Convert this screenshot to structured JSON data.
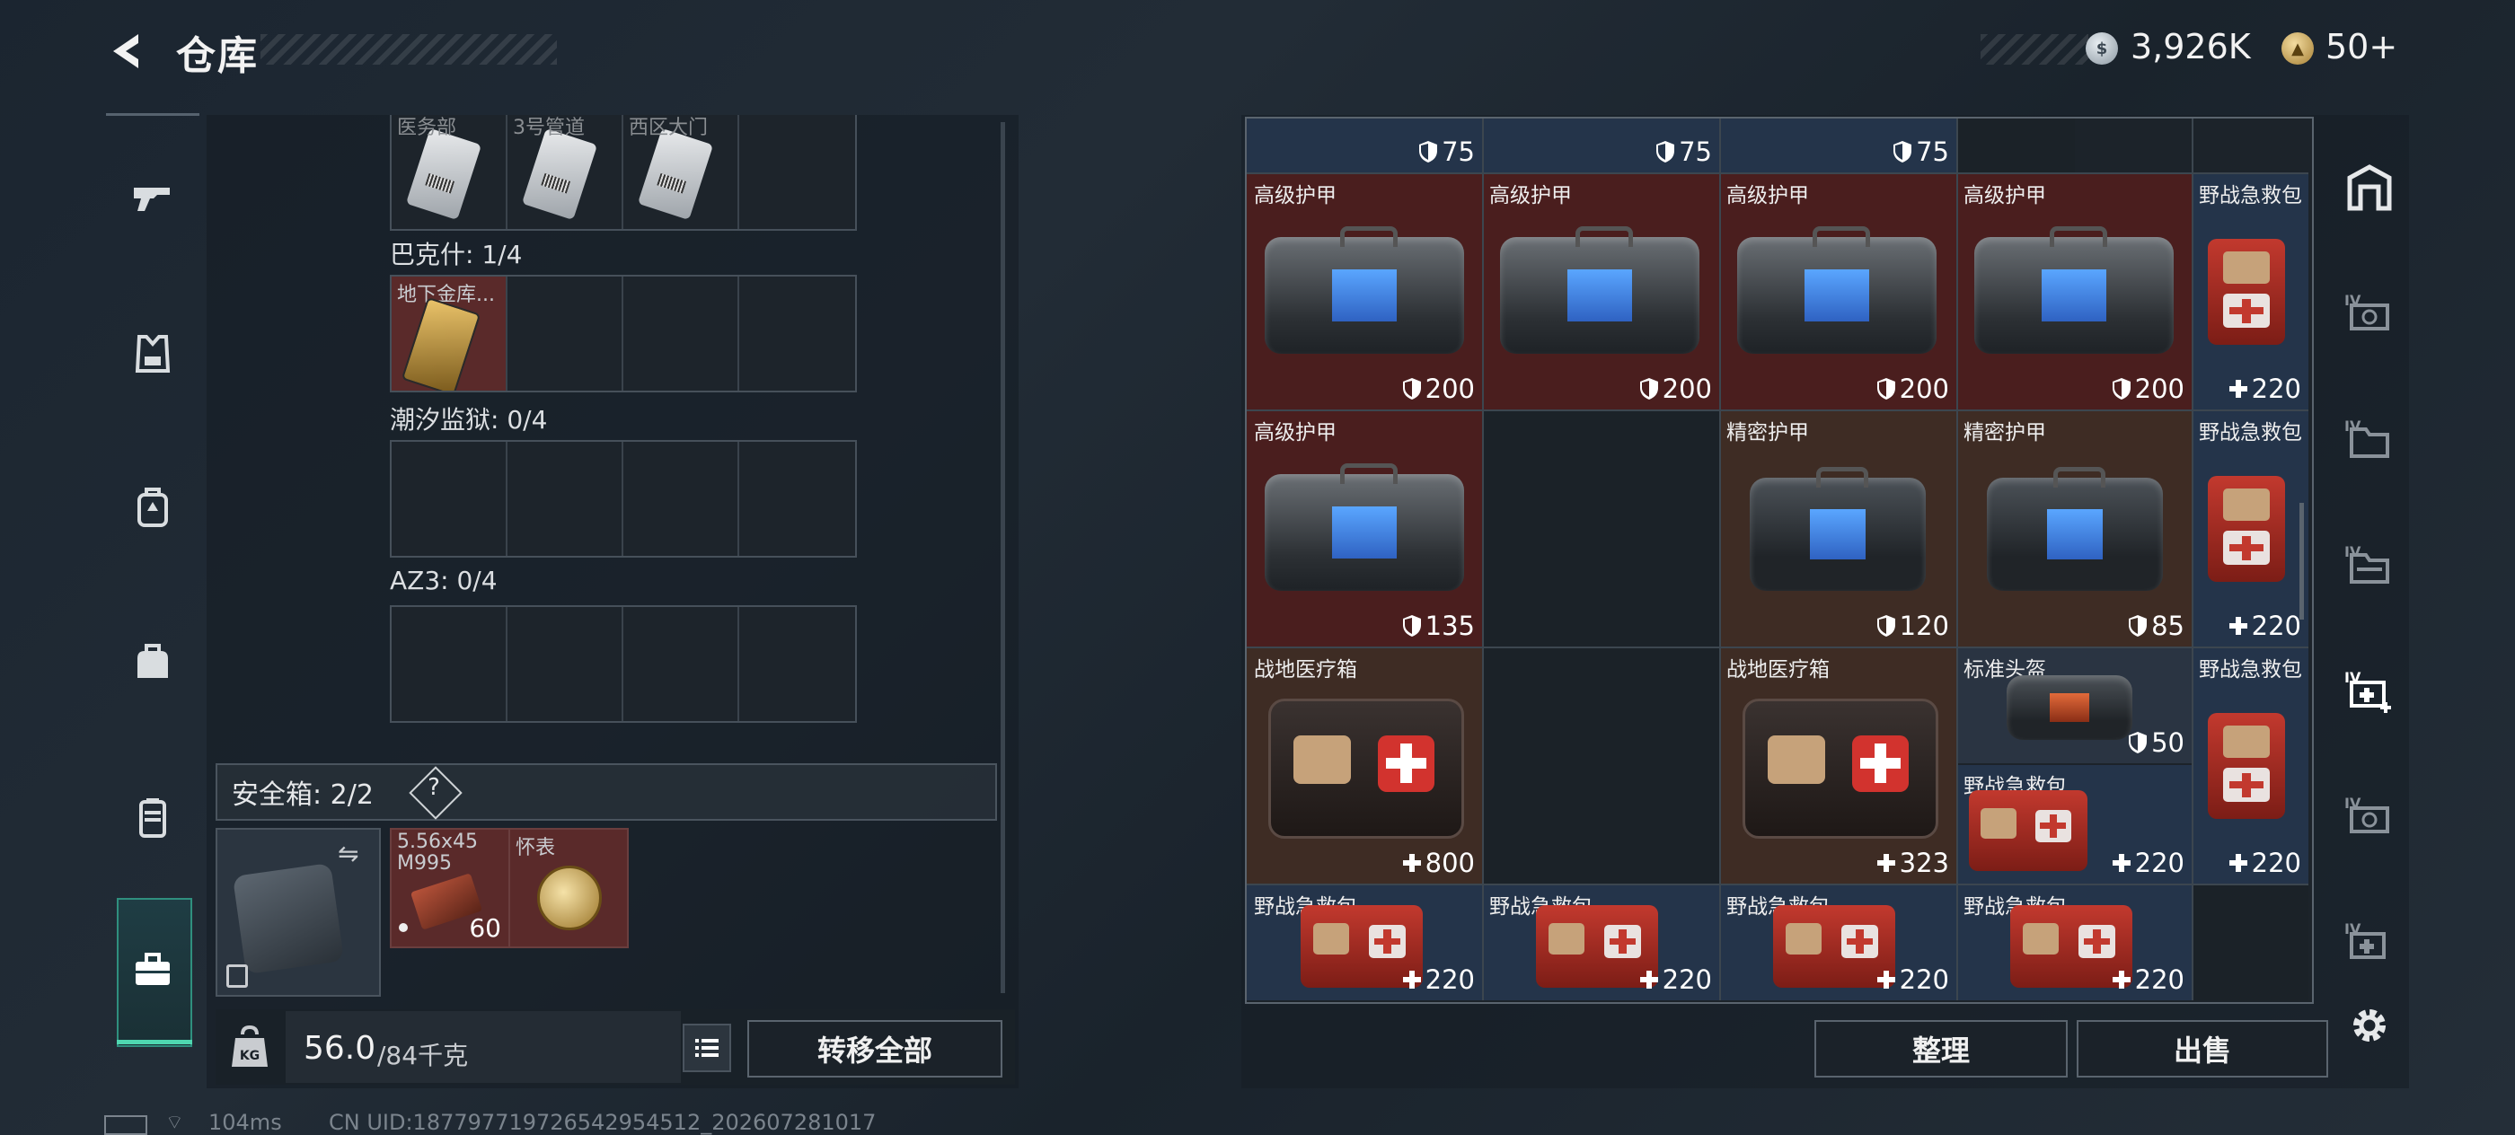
{
  "header": {
    "title": "仓库",
    "currency_silver": "3,926K",
    "currency_gold": "50+"
  },
  "left_nav": [
    {
      "name": "weapon"
    },
    {
      "name": "armor"
    },
    {
      "name": "backpack"
    },
    {
      "name": "bag"
    },
    {
      "name": "case"
    },
    {
      "name": "storage"
    }
  ],
  "key_sections": {
    "top_row": [
      {
        "label": "医务部"
      },
      {
        "label": "3号管道"
      },
      {
        "label": "西区大门"
      },
      {
        "label": ""
      }
    ],
    "bakeshi": {
      "label": "巴克什: 1/4",
      "items": [
        {
          "label": "地下金库..."
        }
      ]
    },
    "chaoxi": {
      "label": "潮汐监狱: 0/4"
    },
    "az3": {
      "label": "AZ3: 0/4"
    }
  },
  "safe_box": {
    "label": "安全箱: 2/2",
    "help": "?",
    "items": [
      {
        "label": "5.56x45 M995",
        "count": "60"
      },
      {
        "label": "怀表"
      }
    ]
  },
  "weight": {
    "value": "56.0",
    "max": "/84千克"
  },
  "buttons": {
    "transfer_all": "转移全部",
    "sort": "整理",
    "sell": "出售"
  },
  "status": {
    "ping": "104ms",
    "uid": "CN UID:187797719726542954512_202607281017"
  },
  "grid": {
    "top_row_values": [
      "75",
      "75",
      "75"
    ],
    "items": [
      {
        "label": "高级护甲",
        "value": "200",
        "kind": "armor"
      },
      {
        "label": "高级护甲",
        "value": "200",
        "kind": "armor"
      },
      {
        "label": "高级护甲",
        "value": "200",
        "kind": "armor"
      },
      {
        "label": "高级护甲",
        "value": "200",
        "kind": "armor"
      },
      {
        "label": "野战急救包",
        "value": "220",
        "kind": "heal"
      },
      {
        "label": "高级护甲",
        "value": "135",
        "kind": "armor"
      },
      {
        "label": "精密护甲",
        "value": "120",
        "kind": "armor"
      },
      {
        "label": "精密护甲",
        "value": "85",
        "kind": "armor"
      },
      {
        "label": "野战急救包",
        "value": "220",
        "kind": "heal"
      },
      {
        "label": "战地医疗箱",
        "value": "800",
        "kind": "heal"
      },
      {
        "label": "战地医疗箱",
        "value": "323",
        "kind": "heal"
      },
      {
        "label": "标准头盔",
        "value": "50",
        "kind": "armor"
      },
      {
        "label": "野战急救包",
        "value": "220",
        "kind": "heal"
      },
      {
        "label": "野战急救包",
        "value": "220",
        "kind": "heal"
      },
      {
        "label": "野战急救包",
        "value": "220",
        "kind": "heal"
      },
      {
        "label": "野战急救包",
        "value": "220",
        "kind": "heal"
      },
      {
        "label": "野战急救包",
        "value": "220",
        "kind": "heal"
      },
      {
        "label": "野战急救包",
        "value": "220",
        "kind": "heal"
      }
    ]
  },
  "right_nav": [
    {
      "name": "container"
    },
    {
      "name": "tab-4"
    },
    {
      "name": "tab-5"
    },
    {
      "name": "tab-6"
    },
    {
      "name": "tab-7-active"
    },
    {
      "name": "tab-8"
    },
    {
      "name": "tab-9"
    },
    {
      "name": "settings"
    }
  ],
  "colors": {
    "accent": "#4fd7b0",
    "armor_bg": "#4a1e1e",
    "heal_bg": "#24344a",
    "medbox_bg": "#3e2c24"
  }
}
